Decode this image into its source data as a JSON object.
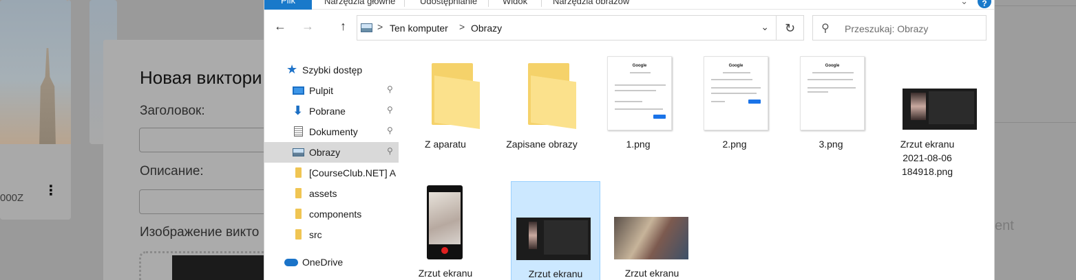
{
  "background": {
    "card_meta": "000Z",
    "card_menu_glyph": "⋮",
    "modal": {
      "title": "Новая виктори",
      "field_title_label": "Заголовок:",
      "field_description_label": "Описание:",
      "field_image_label": "Изображение викто"
    },
    "right_partial_text": "ent"
  },
  "explorer": {
    "ribbon": {
      "tabs": [
        "Plik",
        "Narzędzia główne",
        "Udostępnianie",
        "Widok",
        "Narzędzia obrazów"
      ],
      "help_glyph": "?",
      "collapse_glyph": "⌄"
    },
    "nav": {
      "back_glyph": "←",
      "forward_glyph": "→",
      "up_glyph": "↑",
      "breadcrumb": [
        "Ten komputer",
        "Obrazy"
      ],
      "crumb_separator": ">",
      "dropdown_glyph": "⌄",
      "refresh_glyph": "↻",
      "search_placeholder": "Przeszukaj: Obrazy",
      "search_icon": "search-icon"
    },
    "navpane": {
      "items": [
        {
          "label": "Szybki dostęp",
          "icon": "star-icon",
          "pinned": false,
          "top": true
        },
        {
          "label": "Pulpit",
          "icon": "desktop-icon",
          "pinned": true
        },
        {
          "label": "Pobrane",
          "icon": "download-icon",
          "pinned": true
        },
        {
          "label": "Dokumenty",
          "icon": "document-icon",
          "pinned": true
        },
        {
          "label": "Obrazy",
          "icon": "pictures-icon",
          "pinned": true,
          "selected": true
        },
        {
          "label": "[CourseClub.NET] A",
          "icon": "folder-icon"
        },
        {
          "label": "assets",
          "icon": "folder-icon"
        },
        {
          "label": "components",
          "icon": "folder-icon"
        },
        {
          "label": "src",
          "icon": "folder-icon"
        },
        {
          "label": "OneDrive",
          "icon": "cloud-icon",
          "top": true
        }
      ],
      "pin_glyph": "📌"
    },
    "files": [
      {
        "name": "Z aparatu",
        "kind": "folder"
      },
      {
        "name": "Zapisane obrazy",
        "kind": "folder"
      },
      {
        "name": "1.png",
        "kind": "image"
      },
      {
        "name": "2.png",
        "kind": "image"
      },
      {
        "name": "3.png",
        "kind": "image"
      },
      {
        "name": "Zrzut ekranu\n2021-08-06\n184918.png",
        "kind": "image"
      },
      {
        "name": "Zrzut ekranu",
        "kind": "image"
      },
      {
        "name": "Zrzut ekranu",
        "kind": "image",
        "selected": true
      },
      {
        "name": "Zrzut ekranu",
        "kind": "image"
      }
    ],
    "thumb_text": {
      "google_logo": "Google",
      "shot1_heading": "Вход",
      "shot2_heading": "Аккаунт удален",
      "shot3_heading": "Не удалось войти в аккаунт"
    }
  },
  "colors": {
    "accent": "#1979ca",
    "selection_bg": "#cce8ff",
    "selection_border": "#99d1ff",
    "nav_selected_bg": "#d9d9d9",
    "folder_yellow": "#f5d26a"
  }
}
